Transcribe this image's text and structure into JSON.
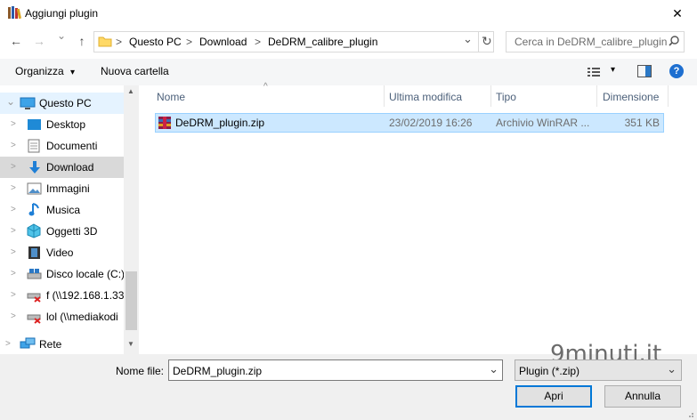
{
  "window": {
    "title": "Aggiungi plugin",
    "close_glyph": "✕"
  },
  "nav": {
    "back": "←",
    "forward": "→",
    "recent": "⌄",
    "up": "↑",
    "breadcrumb": [
      "Questo PC",
      "Download",
      "DeDRM_calibre_plugin"
    ],
    "separator": ">",
    "dropdown_glyph": "⌄",
    "refresh_glyph": "↻"
  },
  "search": {
    "placeholder": "Cerca in DeDRM_calibre_plugin"
  },
  "toolbar": {
    "organize": "Organizza",
    "organize_arrow": "▾",
    "new_folder": "Nuova cartella",
    "view_arrow": "▾",
    "help": "?"
  },
  "sidebar": {
    "items": [
      {
        "label": "Questo PC",
        "icon": "pc-icon"
      },
      {
        "label": "Desktop",
        "icon": "desktop-icon"
      },
      {
        "label": "Documenti",
        "icon": "documents-icon"
      },
      {
        "label": "Download",
        "icon": "download-icon"
      },
      {
        "label": "Immagini",
        "icon": "pictures-icon"
      },
      {
        "label": "Musica",
        "icon": "music-icon"
      },
      {
        "label": "Oggetti 3D",
        "icon": "objects3d-icon"
      },
      {
        "label": "Video",
        "icon": "video-icon"
      },
      {
        "label": "Disco locale (C:)",
        "icon": "disk-icon"
      },
      {
        "label": "f (\\\\192.168.1.33)",
        "icon": "network-drive-icon"
      },
      {
        "label": "lol (\\\\mediakodi",
        "icon": "network-drive-icon"
      },
      {
        "label": "Rete",
        "icon": "network-icon"
      }
    ],
    "chevron": ">",
    "expanded_chevron": "⌄",
    "scroll_up": "▲",
    "scroll_down": "▼"
  },
  "columns": {
    "name": "Nome",
    "modified": "Ultima modifica",
    "type": "Tipo",
    "size": "Dimensione",
    "sort_glyph": "^"
  },
  "files": [
    {
      "name": "DeDRM_plugin.zip",
      "modified": "23/02/2019 16:26",
      "type": "Archivio WinRAR ...",
      "size": "351 KB"
    }
  ],
  "bottom": {
    "filename_label": "Nome file:",
    "filename_value": "DeDRM_plugin.zip",
    "filetype_value": "Plugin (*.zip)",
    "open": "Apri",
    "cancel": "Annulla",
    "dropdown_glyph": "⌄"
  },
  "watermark": "9minuti.it",
  "colors": {
    "accent": "#0078d7",
    "selection": "#cce8ff",
    "selection_border": "#99d1ff",
    "header_text": "#4c607a"
  }
}
